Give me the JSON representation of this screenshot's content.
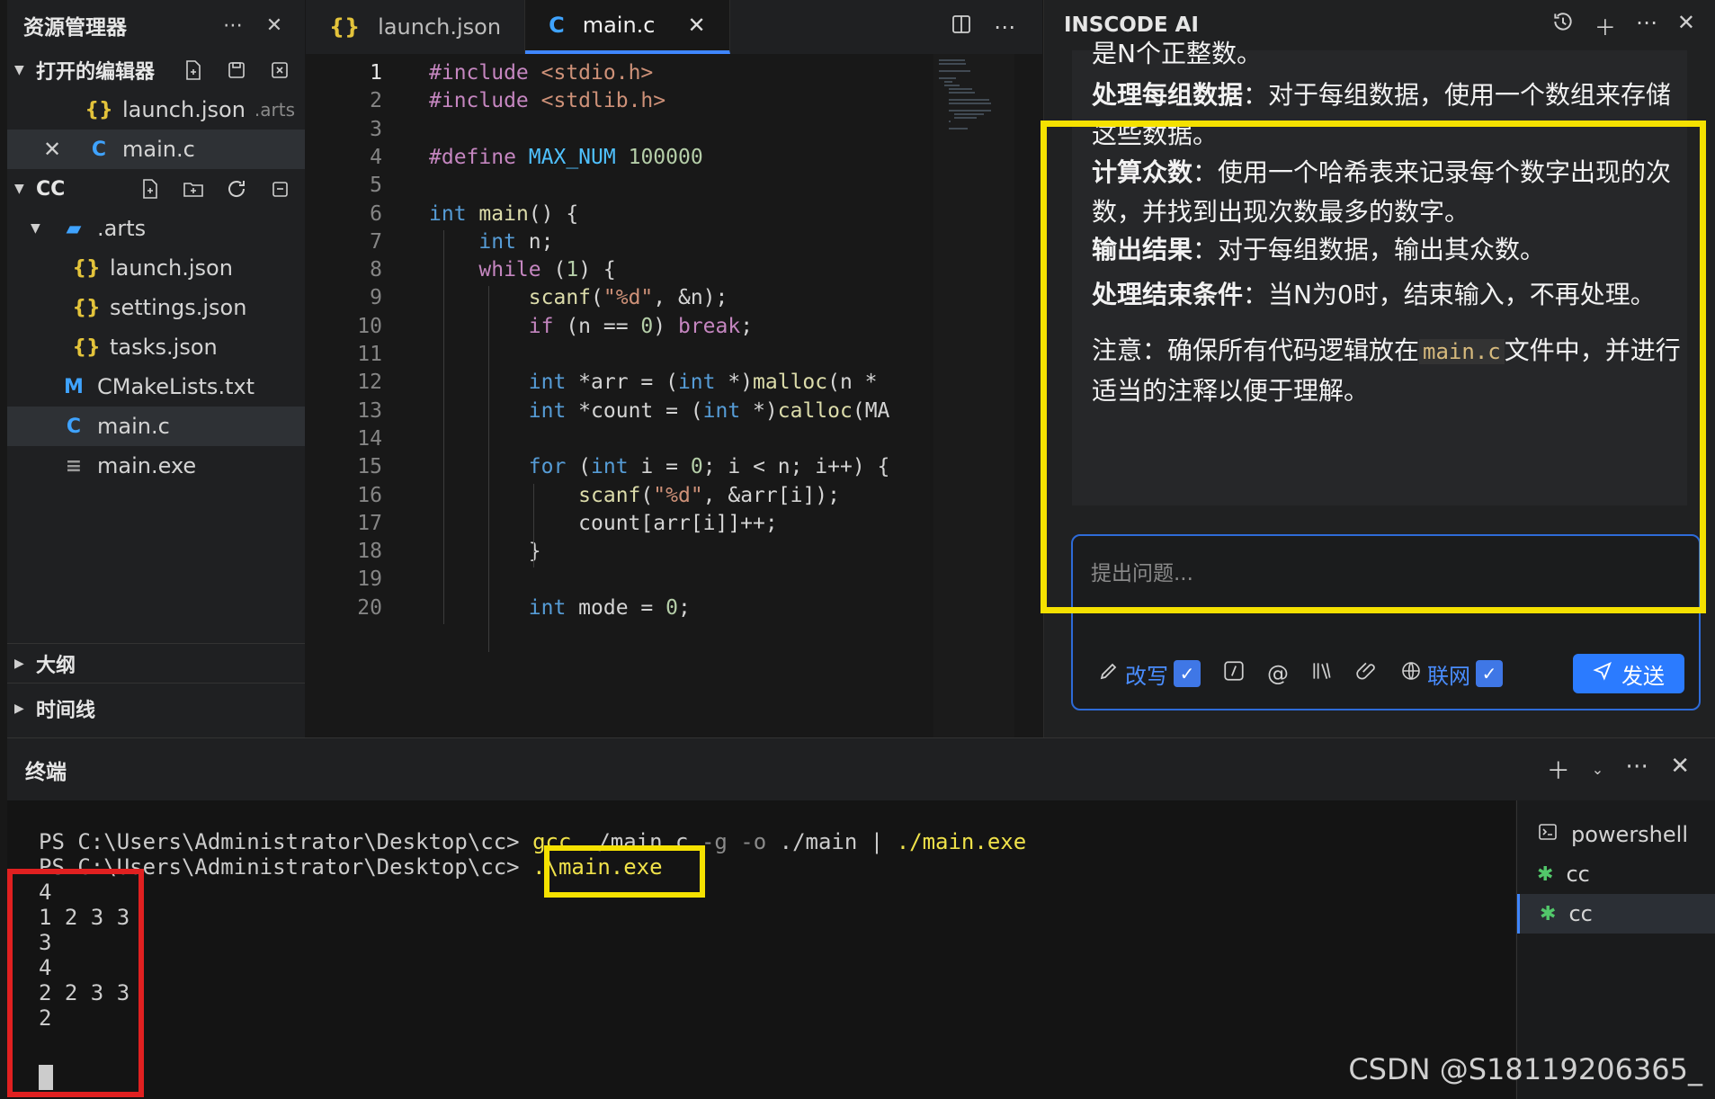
{
  "explorer": {
    "title": "资源管理器",
    "open_editors": {
      "label": "打开的编辑器",
      "items": [
        {
          "icon": "{}",
          "name": "launch.json",
          "sub": ".arts"
        },
        {
          "icon": "C",
          "name": "main.c",
          "sub": ""
        }
      ]
    },
    "folder": {
      "label": "CC",
      "items": [
        {
          "icon": "folder",
          "name": ".arts"
        },
        {
          "icon": "{}",
          "name": "launch.json"
        },
        {
          "icon": "{}",
          "name": "settings.json"
        },
        {
          "icon": "{}",
          "name": "tasks.json"
        },
        {
          "icon": "M",
          "name": "CMakeLists.txt"
        },
        {
          "icon": "C",
          "name": "main.c"
        },
        {
          "icon": "≡",
          "name": "main.exe"
        }
      ]
    },
    "outline": "大纲",
    "timeline": "时间线"
  },
  "tabs": [
    {
      "icon": "{}",
      "label": "launch.json"
    },
    {
      "icon": "C",
      "label": "main.c"
    }
  ],
  "editor": {
    "line_numbers": [
      "1",
      "2",
      "3",
      "4",
      "5",
      "6",
      "7",
      "8",
      "9",
      "10",
      "11",
      "12",
      "13",
      "14",
      "15",
      "16",
      "17",
      "18",
      "19",
      "20"
    ],
    "lines": [
      "#include <stdio.h>",
      "#include <stdlib.h>",
      "",
      "#define MAX_NUM 100000",
      "",
      "int main() {",
      "    int n;",
      "    while (1) {",
      "        scanf(\"%d\", &n);",
      "        if (n == 0) break;",
      "",
      "        int *arr = (int *)malloc(n *",
      "        int *count = (int *)calloc(MA",
      "",
      "        for (int i = 0; i < n; i++) {",
      "            scanf(\"%d\", &arr[i]);",
      "            count[arr[i]]++;",
      "        }",
      "",
      "        int mode = 0;"
    ]
  },
  "chat": {
    "title": "INSCODE AI",
    "para0": "是N个正整数。",
    "items": [
      {
        "bold": "处理每组数据",
        "text": "：对于每组数据，使用一个数组来存储这些数据。"
      },
      {
        "bold": "计算众数",
        "text": "：使用一个哈希表来记录每个数字出现的次数，并找到出现次数最多的数字。"
      },
      {
        "bold": "输出结果",
        "text": "：对于每组数据，输出其众数。"
      },
      {
        "bold": "处理结束条件",
        "text": "：当N为0时，结束输入，不再处理。"
      }
    ],
    "note_prefix": "注意：确保所有代码逻辑放在",
    "note_code": "main.c",
    "note_suffix": "文件中，并进行适当的注释以便于理解。",
    "input_placeholder": "提出问题...",
    "rewrite_label": "改写",
    "web_label": "联网",
    "send_label": "发送"
  },
  "terminal": {
    "title": "终端",
    "prompt": "PS C:\\Users\\Administrator\\Desktop\\cc>",
    "cmd1_a": "gcc",
    "cmd1_b": " ./main.c ",
    "cmd1_c": "-g -o",
    "cmd1_d": " ./main | ",
    "cmd1_e": "./main.exe",
    "cmd2": ".\\main.exe",
    "output": [
      "4",
      "1 2 3 3",
      "3",
      "4",
      "2 2 3 3",
      "2"
    ],
    "sessions": [
      {
        "icon": "powershell-icon",
        "label": "powershell"
      },
      {
        "icon": "bug-icon",
        "label": "cc"
      },
      {
        "icon": "bug-icon",
        "label": "cc"
      }
    ]
  },
  "watermark": "CSDN @S18119206365_",
  "colors": {
    "highlight_yellow": "#f5e100",
    "highlight_red": "#e02020",
    "accent": "#3f86ff"
  }
}
